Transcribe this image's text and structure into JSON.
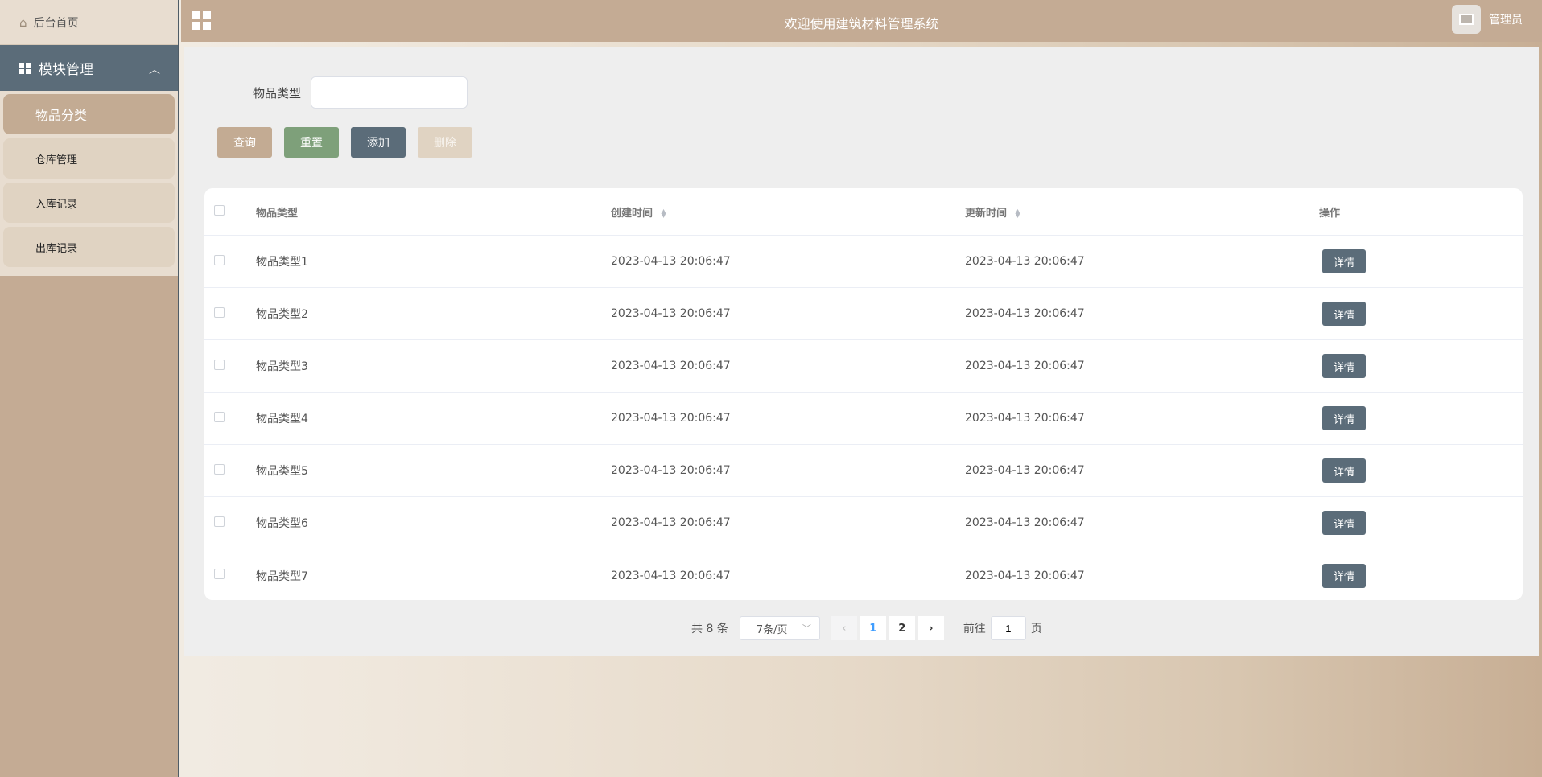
{
  "sidebar": {
    "home_label": "后台首页",
    "module_label": "模块管理",
    "items": [
      {
        "label": "物品分类",
        "active": true
      },
      {
        "label": "仓库管理",
        "active": false
      },
      {
        "label": "入库记录",
        "active": false
      },
      {
        "label": "出库记录",
        "active": false
      }
    ]
  },
  "header": {
    "title": "欢迎使用建筑材料管理系统",
    "username": "管理员"
  },
  "search": {
    "label": "物品类型",
    "value": "",
    "placeholder": ""
  },
  "toolbar": {
    "query_label": "查询",
    "reset_label": "重置",
    "add_label": "添加",
    "delete_label": "删除"
  },
  "table": {
    "columns": [
      "物品类型",
      "创建时间",
      "更新时间",
      "操作"
    ],
    "detail_label": "详情",
    "rows": [
      {
        "type": "物品类型1",
        "created": "2023-04-13 20:06:47",
        "updated": "2023-04-13 20:06:47"
      },
      {
        "type": "物品类型2",
        "created": "2023-04-13 20:06:47",
        "updated": "2023-04-13 20:06:47"
      },
      {
        "type": "物品类型3",
        "created": "2023-04-13 20:06:47",
        "updated": "2023-04-13 20:06:47"
      },
      {
        "type": "物品类型4",
        "created": "2023-04-13 20:06:47",
        "updated": "2023-04-13 20:06:47"
      },
      {
        "type": "物品类型5",
        "created": "2023-04-13 20:06:47",
        "updated": "2023-04-13 20:06:47"
      },
      {
        "type": "物品类型6",
        "created": "2023-04-13 20:06:47",
        "updated": "2023-04-13 20:06:47"
      },
      {
        "type": "物品类型7",
        "created": "2023-04-13 20:06:47",
        "updated": "2023-04-13 20:06:47"
      }
    ]
  },
  "pagination": {
    "total_text": "共 8 条",
    "page_size": "7条/页",
    "pages": [
      "1",
      "2"
    ],
    "current_page": "1",
    "goto_prefix": "前往",
    "goto_value": "1",
    "goto_suffix": "页"
  },
  "colors": {
    "accent_tan": "#c4ab94",
    "slate": "#5b6c79",
    "green": "#7ea07a"
  }
}
